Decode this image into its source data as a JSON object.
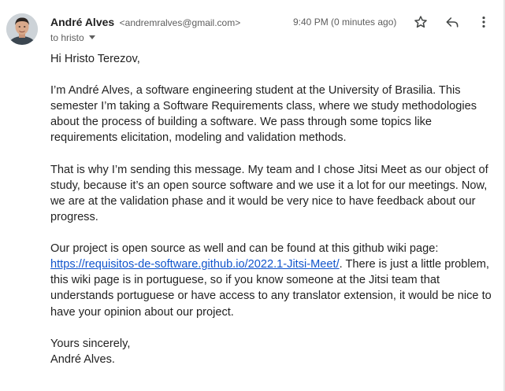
{
  "header": {
    "sender_name": "André Alves",
    "sender_email": "<andremralves@gmail.com>",
    "recipient": "to hristo",
    "timestamp": "9:40 PM (0 minutes ago)"
  },
  "icons": {
    "avatar": "avatar-photo",
    "star": "star-icon",
    "reply": "reply-icon",
    "more": "more-vert-icon",
    "recipient_details": "caret-down-icon"
  },
  "body": {
    "greeting": "Hi Hristo Terezov,",
    "p1": "I’m André Alves, a software engineering student at the University of Brasilia. This semester I’m taking a Software Requirements class, where we study methodologies about the process of building a software. We pass through some topics like requirements elicitation, modeling and validation methods.",
    "p2": "That is why I’m sending this message. My team and I chose Jitsi Meet as our object of study, because it’s an open source software and we use it a lot for our meetings. Now, we are at the validation phase and it would be very nice to have feedback about our progress.",
    "p3_intro": "Our project is open source as well and can be found at this github wiki page:",
    "p3_link": "https://requisitos-de-software.github.io/2022.1-Jitsi-Meet/",
    "p3_rest": ". There is just a little problem, this wiki page is in portuguese, so if you know someone at the Jitsi team that understands portuguese or have access to any translator extension, it would be nice to have your opinion about our project.",
    "closing": "Yours sincerely,",
    "signature": "André Alves."
  },
  "colors": {
    "link": "#1155cc",
    "text": "#222222",
    "muted": "#5e5e5e"
  }
}
